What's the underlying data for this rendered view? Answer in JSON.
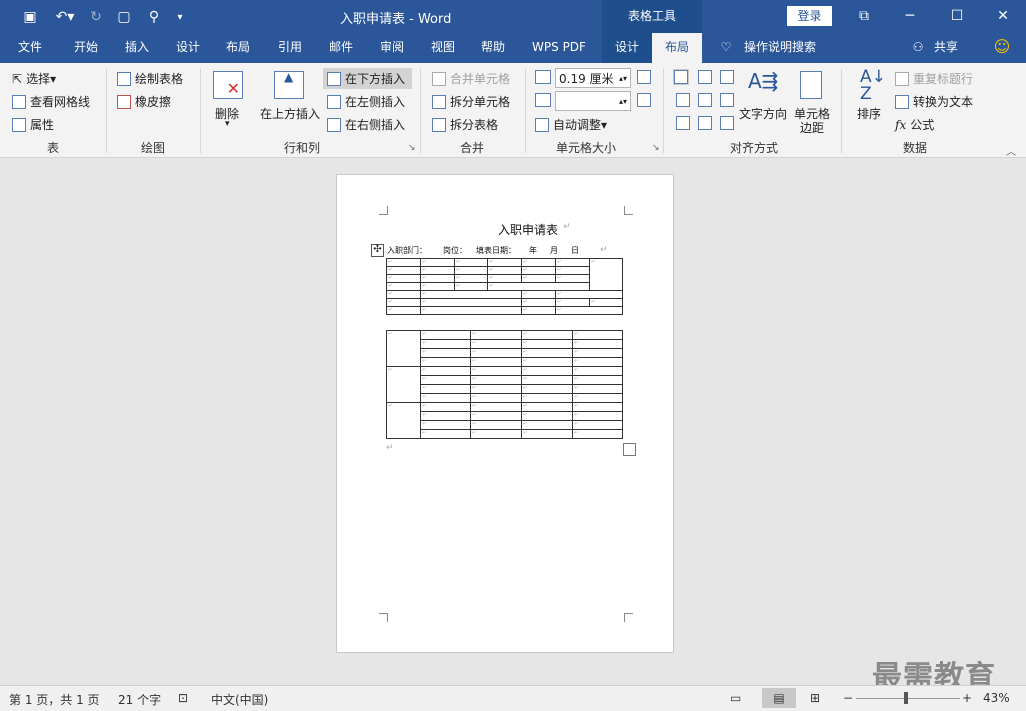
{
  "titlebar": {
    "doc_title": "入职申请表  -  Word",
    "context_tools": "表格工具",
    "login": "登录",
    "minimize": "─",
    "maximize": "☐",
    "close": "✕",
    "restore": "⧉"
  },
  "tabs": [
    "文件",
    "开始",
    "插入",
    "设计",
    "布局",
    "引用",
    "邮件",
    "审阅",
    "视图",
    "帮助",
    "WPS PDF",
    "设计",
    "布局"
  ],
  "tellme": "操作说明搜索",
  "share": "共享",
  "ribbon": {
    "table": {
      "select": "选择",
      "view_grid": "查看网格线",
      "properties": "属性",
      "label": "表"
    },
    "draw": {
      "draw_table": "绘制表格",
      "eraser": "橡皮擦",
      "label": "绘图"
    },
    "rows_cols": {
      "delete": "删除",
      "insert_above": "在上方插入",
      "insert_below": "在下方插入",
      "insert_left": "在左侧插入",
      "insert_right": "在右侧插入",
      "label": "行和列"
    },
    "merge": {
      "merge_cells": "合并单元格",
      "split_cells": "拆分单元格",
      "split_table": "拆分表格",
      "label": "合并"
    },
    "cell_size": {
      "height": "0.19 厘米",
      "width": "",
      "autofit": "自动调整",
      "label": "单元格大小"
    },
    "alignment": {
      "text_direction": "文字方向",
      "cell_margins_1": "单元格",
      "cell_margins_2": "边距",
      "label": "对齐方式"
    },
    "data": {
      "sort": "排序",
      "repeat_header": "重复标题行",
      "convert_text": "转换为文本",
      "formula": "公式",
      "label": "数据"
    }
  },
  "document": {
    "heading": "入职申请表",
    "info_dept": "入职部门：",
    "info_post": "岗位：",
    "info_date": "填表日期：",
    "info_year": "年",
    "info_month": "月",
    "info_day": "日"
  },
  "status": {
    "page": "第 1 页，共 1 页",
    "words": "21 个字",
    "lang": "中文(中国)",
    "zoom": "43%"
  },
  "watermark": "最需教育"
}
